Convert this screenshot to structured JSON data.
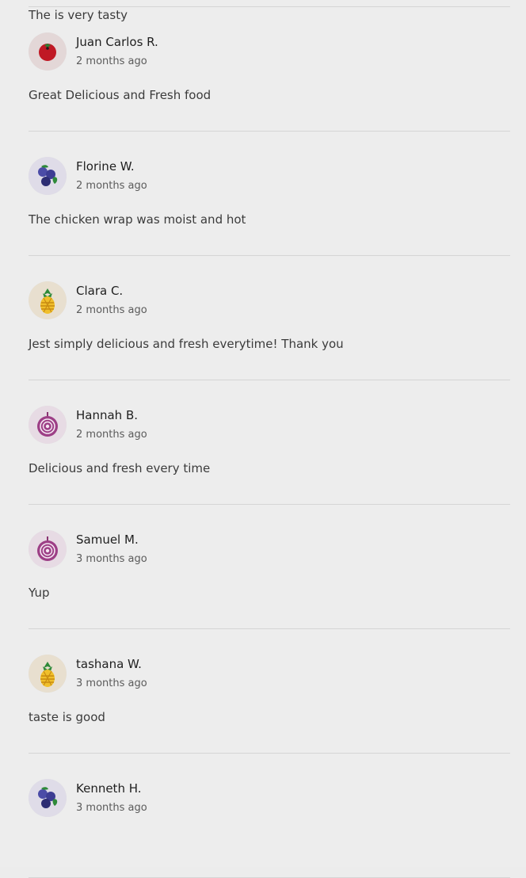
{
  "reviews": [
    {
      "text": "The is very tasty"
    },
    {
      "name": "Juan Carlos R.",
      "time": "2 months ago",
      "text": "Great Delicious and Fresh food",
      "avatar_icon": "tomato-icon"
    },
    {
      "name": "Florine W.",
      "time": "2 months ago",
      "text": "The chicken wrap was moist and hot",
      "avatar_icon": "blueberries-icon"
    },
    {
      "name": "Clara C.",
      "time": "2 months ago",
      "text": "Jest simply delicious and fresh everytime! Thank you",
      "avatar_icon": "pineapple-icon"
    },
    {
      "name": "Hannah B.",
      "time": "2 months ago",
      "text": "Delicious and fresh every time",
      "avatar_icon": "onion-icon"
    },
    {
      "name": "Samuel M.",
      "time": "3 months ago",
      "text": "Yup",
      "avatar_icon": "onion-icon"
    },
    {
      "name": "tashana W.",
      "time": "3 months ago",
      "text": "taste is good",
      "avatar_icon": "pineapple-icon"
    },
    {
      "name": "Kenneth H.",
      "time": "3 months ago",
      "text": "",
      "avatar_icon": "blueberries-icon"
    }
  ]
}
